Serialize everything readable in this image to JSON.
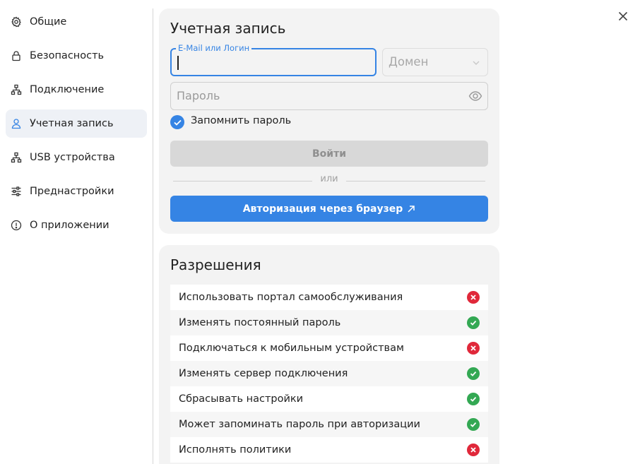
{
  "sidebar": {
    "items": [
      {
        "label": "Общие",
        "icon": "gear-icon"
      },
      {
        "label": "Безопасность",
        "icon": "lock-icon"
      },
      {
        "label": "Подключение",
        "icon": "network-icon"
      },
      {
        "label": "Учетная запись",
        "icon": "user-icon",
        "active": true
      },
      {
        "label": "USB устройства",
        "icon": "usb-icon"
      },
      {
        "label": "Преднастройки",
        "icon": "sliders-icon"
      },
      {
        "label": "О приложении",
        "icon": "info-icon"
      }
    ]
  },
  "account": {
    "title": "Учетная запись",
    "login_label": "E-Mail или Логин",
    "login_value": "",
    "domain_placeholder": "Домен",
    "password_placeholder": "Пароль",
    "remember_label": "Запомнить пароль",
    "remember_checked": true,
    "login_button": "Войти",
    "separator": "или",
    "browser_button": "Авторизация через браузер"
  },
  "permissions": {
    "title": "Разрешения",
    "items": [
      {
        "label": "Использовать портал самообслуживания",
        "allowed": false
      },
      {
        "label": "Изменять постоянный пароль",
        "allowed": true
      },
      {
        "label": "Подключаться к мобильным устройствам",
        "allowed": false
      },
      {
        "label": "Изменять сервер подключения",
        "allowed": true
      },
      {
        "label": "Сбрасывать настройки",
        "allowed": true
      },
      {
        "label": "Может запоминать пароль при авторизации",
        "allowed": true
      },
      {
        "label": "Исполнять политики",
        "allowed": false
      }
    ]
  },
  "colors": {
    "accent": "#3584e4",
    "allowed": "#33a853",
    "denied": "#e0283a"
  }
}
